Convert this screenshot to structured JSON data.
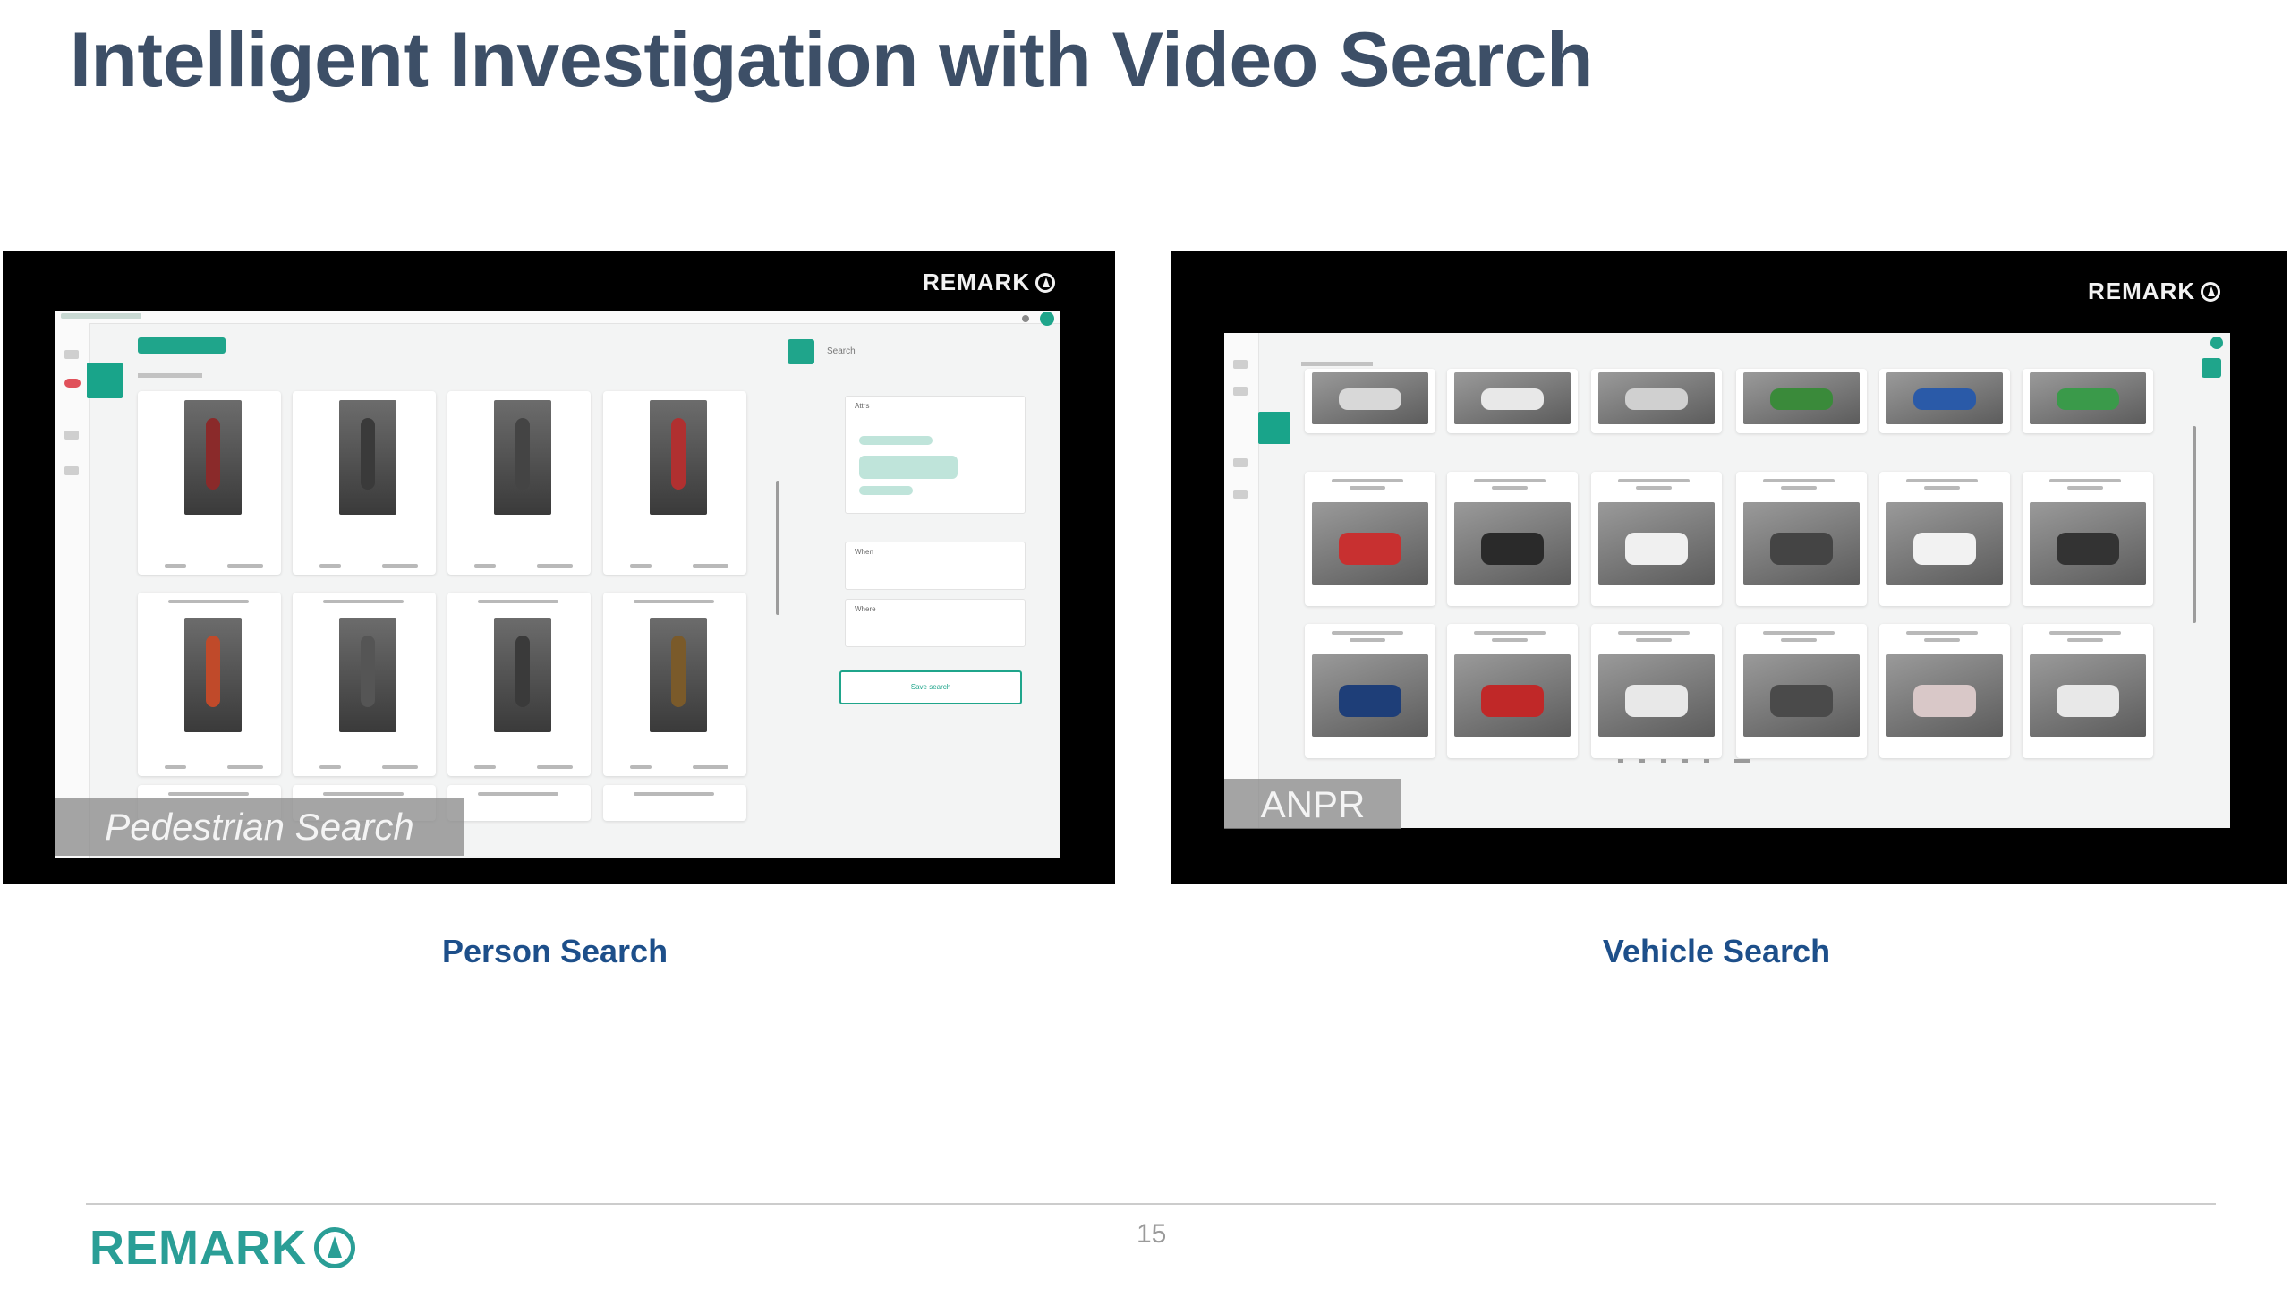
{
  "slide": {
    "title": "Intelligent Investigation with Video Search",
    "page_number": "15"
  },
  "left_panel": {
    "logo_text": "REMARK",
    "overlay_caption": "Pedestrian Search",
    "caption": "Person Search",
    "app": {
      "search_header": "Search",
      "filter_labels": [
        "Attrs",
        "When",
        "Where"
      ],
      "action_button": "Save search"
    }
  },
  "right_panel": {
    "logo_text": "REMARK",
    "overlay_caption": "ANPR",
    "caption": "Vehicle Search"
  },
  "footer": {
    "logo_text": "REMARK"
  },
  "colors": {
    "title": "#3d4f67",
    "caption": "#1d4f8a",
    "brand_teal": "#2a9e96",
    "app_accent": "#1fa58b"
  }
}
